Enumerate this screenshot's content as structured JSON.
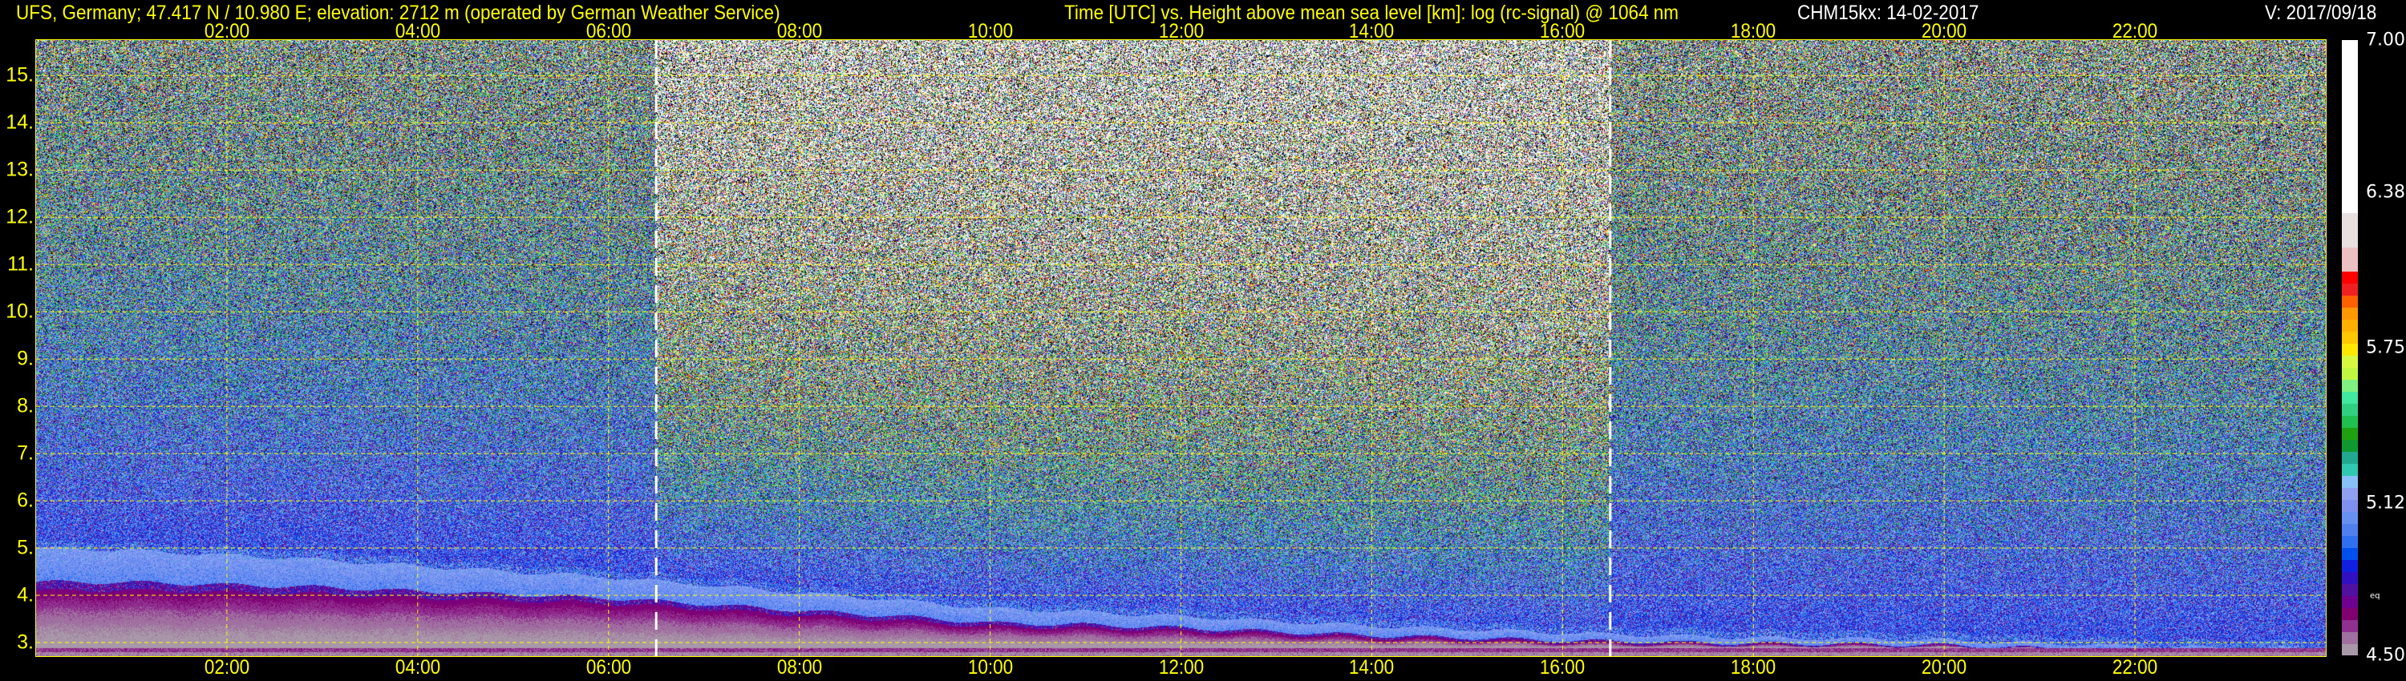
{
  "header": {
    "station": "UFS, Germany; 47.417 N / 10.980 E; elevation: 2712 m  (operated by German Weather Service)",
    "axes_title": "Time [UTC] vs. Height above mean sea level [km]: log (rc-signal) @ 1064 nm",
    "instrument_date": "CHM15kx: 14-02-2017",
    "version": "V: 2017/09/18"
  },
  "colors": {
    "text": "#ffff00",
    "grid": "#ffff00",
    "marker": "#ffffff",
    "background": "#000000"
  },
  "chart_data": {
    "type": "heatmap",
    "title": "Time [UTC] vs. Height above mean sea level [km]: log (rc-signal) @ 1064 nm",
    "xlabel": "Time [UTC]",
    "ylabel": "Height above mean sea level [km]",
    "xlim": [
      0,
      24
    ],
    "ylim": [
      2.712,
      15.75
    ],
    "x_ticks": [
      {
        "value": 2,
        "label": "02:00"
      },
      {
        "value": 4,
        "label": "04:00"
      },
      {
        "value": 6,
        "label": "06:00"
      },
      {
        "value": 8,
        "label": "08:00"
      },
      {
        "value": 10,
        "label": "10:00"
      },
      {
        "value": 12,
        "label": "12:00"
      },
      {
        "value": 14,
        "label": "14:00"
      },
      {
        "value": 16,
        "label": "16:00"
      },
      {
        "value": 18,
        "label": "18:00"
      },
      {
        "value": 20,
        "label": "20:00"
      },
      {
        "value": 22,
        "label": "22:00"
      }
    ],
    "y_ticks": [
      {
        "value": 3,
        "label": "3."
      },
      {
        "value": 4,
        "label": "4."
      },
      {
        "value": 5,
        "label": "5."
      },
      {
        "value": 6,
        "label": "6."
      },
      {
        "value": 7,
        "label": "7."
      },
      {
        "value": 8,
        "label": "8."
      },
      {
        "value": 9,
        "label": "9."
      },
      {
        "value": 10,
        "label": "10."
      },
      {
        "value": 11,
        "label": "11."
      },
      {
        "value": 12,
        "label": "12."
      },
      {
        "value": 13,
        "label": "13."
      },
      {
        "value": 14,
        "label": "14."
      },
      {
        "value": 15,
        "label": "15."
      }
    ],
    "grid": true,
    "dashed_markers_utc": [
      6.5,
      16.5
    ],
    "aerosol_layer_top_km": {
      "time_utc": [
        0,
        1,
        2,
        3,
        4,
        5,
        6,
        7,
        8,
        9,
        10,
        11,
        12,
        13,
        14,
        15,
        16,
        17,
        18,
        19,
        20,
        21,
        22,
        23,
        24
      ],
      "height_km": [
        5.0,
        4.95,
        4.85,
        4.75,
        4.62,
        4.5,
        4.38,
        4.22,
        4.05,
        3.9,
        3.72,
        3.65,
        3.55,
        3.45,
        3.35,
        3.28,
        3.2,
        3.15,
        3.1,
        3.08,
        3.05,
        2.98,
        2.92,
        2.88,
        2.86
      ]
    },
    "aerosol_layer_thickness_km": {
      "time_utc": [
        0,
        6,
        12,
        18,
        24
      ],
      "value": [
        0.9,
        0.55,
        0.3,
        0.15,
        0.1
      ]
    },
    "colorbar": {
      "min": 4.5,
      "max": 7.0,
      "tick_labels": [
        {
          "value": 7.0,
          "label": "7.00"
        },
        {
          "value": 6.38,
          "label": "6.38"
        },
        {
          "value": 5.75,
          "label": "5.75"
        },
        {
          "value": 5.12,
          "label": "5.12"
        },
        {
          "value": 4.5,
          "label": "4.50"
        }
      ],
      "eq_label": {
        "value": 4.74,
        "label": "eq"
      },
      "lower_bands_end": 6.06,
      "lower_colors": [
        "#a898a8",
        "#a070a0",
        "#903090",
        "#800070",
        "#700090",
        "#5010a0",
        "#3010c0",
        "#1020e0",
        "#0050f0",
        "#3070f0",
        "#5080f0",
        "#6890f0",
        "#8090f0",
        "#90a0f0",
        "#88c0f8",
        "#30c8b0",
        "#20a890",
        "#109830",
        "#20a010",
        "#20c050",
        "#30d080",
        "#40e8a0",
        "#80f080",
        "#c0f840",
        "#d8f840",
        "#ffe800",
        "#ffc800",
        "#ffb000",
        "#ff9800",
        "#ff6000",
        "#f02020",
        "#ff0000"
      ],
      "upper_bands": [
        {
          "color": "#ecc0c0",
          "to": 6.16
        },
        {
          "color": "#e8dfe0",
          "to": 6.3
        },
        {
          "color": "#ffffff",
          "to": 7.0
        }
      ]
    }
  }
}
